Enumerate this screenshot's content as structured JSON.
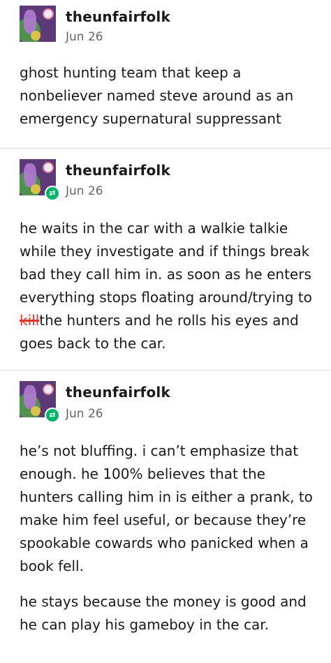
{
  "posts": [
    {
      "username": "theunfairfolk",
      "date": "Jun 26",
      "paragraphs": [
        "ghost hunting team that keep a nonbeliever named steve around as an emergency supernatural suppressant"
      ]
    },
    {
      "username": "theunfairfolk",
      "date": "Jun 26",
      "text_before": "he waits in the car with a walkie talkie while they investigate and if things break bad they call him in. as soon as he enters everything stops floating around/trying to ",
      "struck": "kill",
      "text_after": "the hunters and he rolls his eyes and goes back to the car."
    },
    {
      "username": "theunfairfolk",
      "date": "Jun 26",
      "paragraphs": [
        "he’s not bluffing. i can’t emphasize that enough. he 100% believes that the hunters calling him in is either a prank, to make him feel useful, or because they’re spookable cowards who panicked when a book fell.",
        "he stays because the money is good and he can play his gameboy in the car."
      ]
    }
  ],
  "reblog_icon": "reblog-icon",
  "colors": {
    "reblog_badge": "#00b36b",
    "strike": "#e0342d"
  }
}
